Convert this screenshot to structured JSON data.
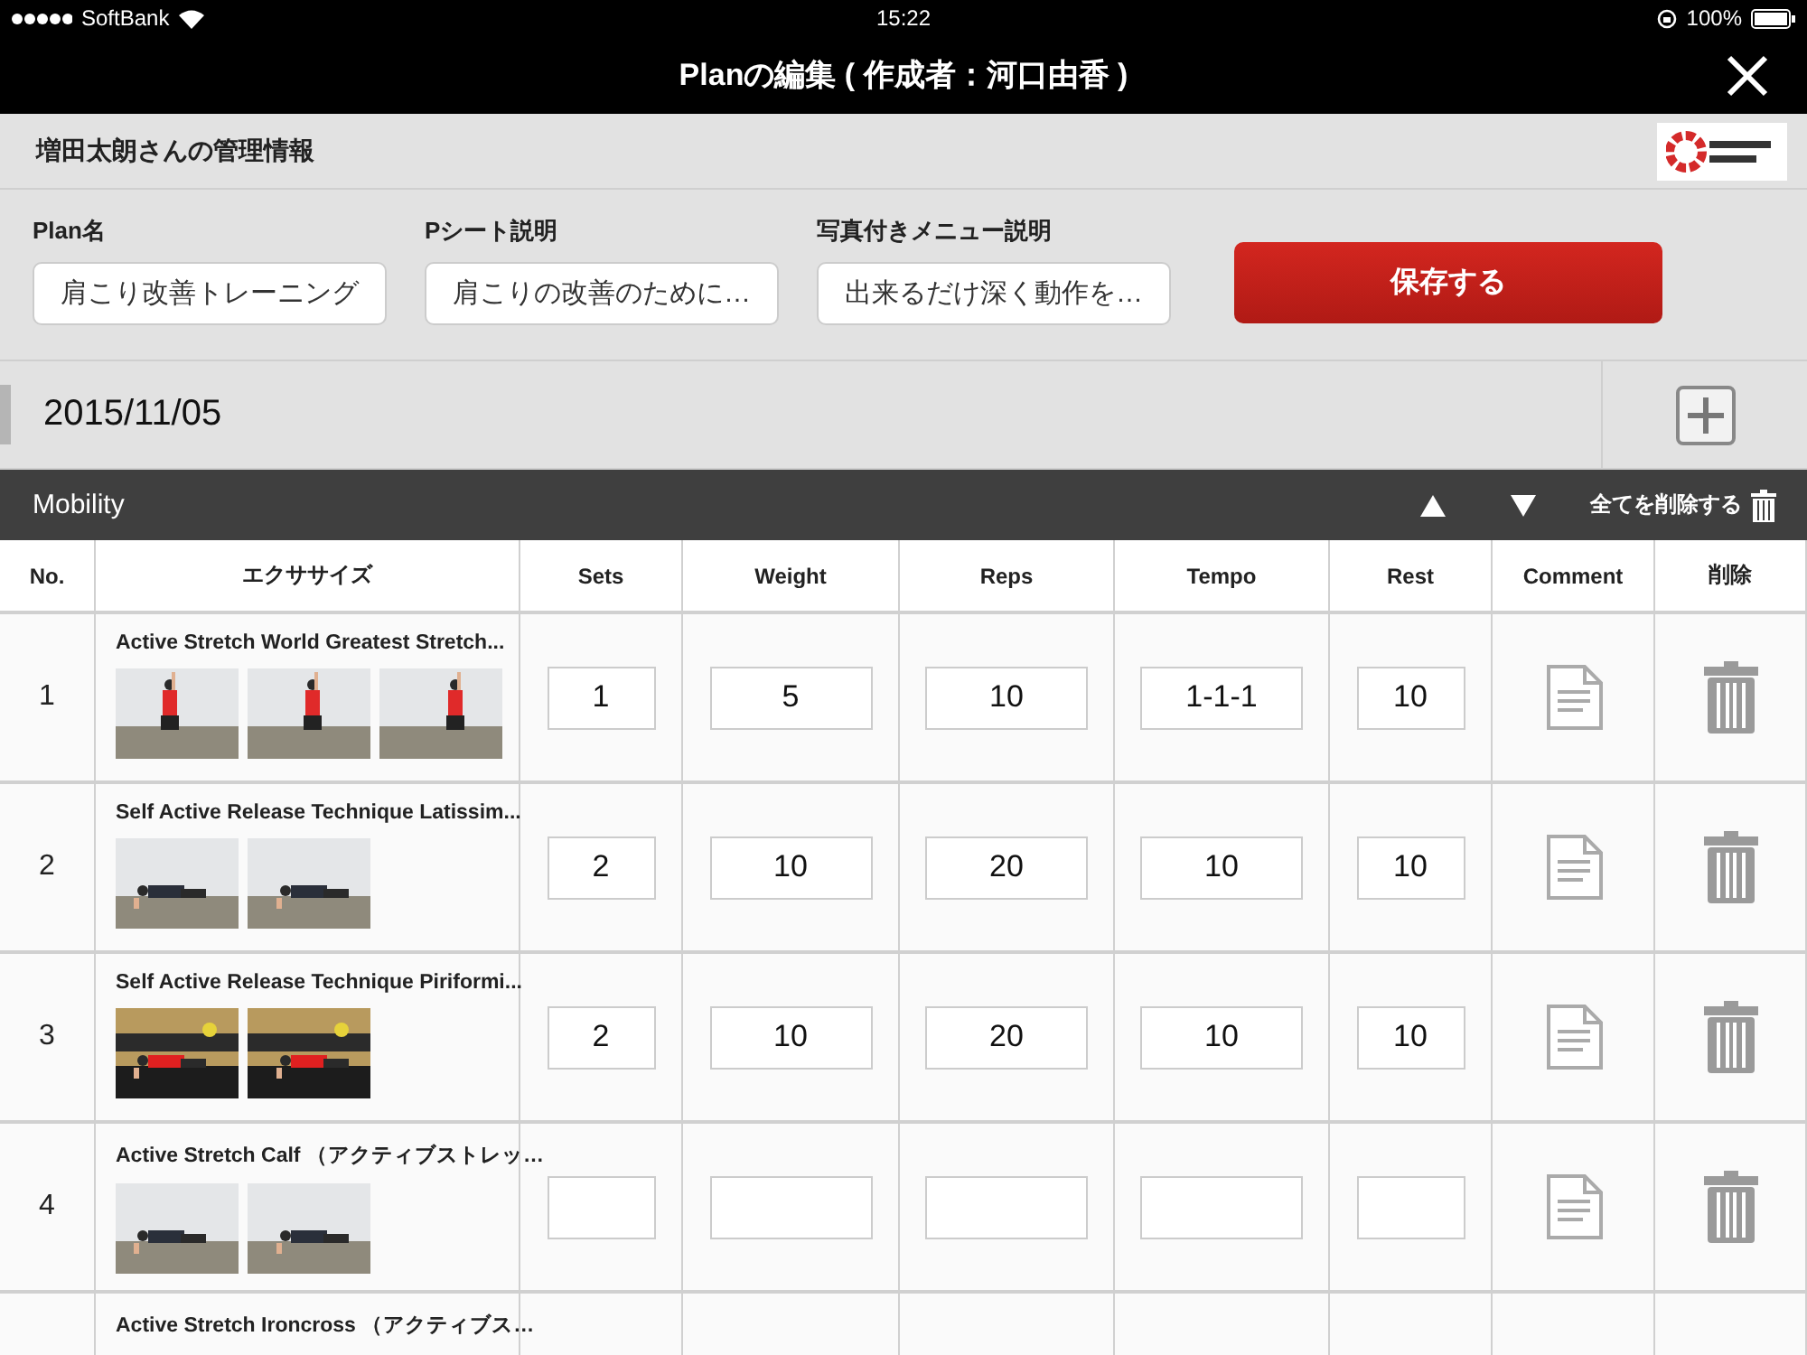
{
  "status_bar": {
    "carrier": "SoftBank",
    "time": "15:22",
    "battery": "100%"
  },
  "title_bar": {
    "title": "Planの編集 ( 作成者：河口由香 )"
  },
  "header": {
    "title": "増田太朗さんの管理情報"
  },
  "form": {
    "fields": [
      {
        "label": "Plan名",
        "value": "肩こり改善トレーニング"
      },
      {
        "label": "Pシート説明",
        "value": "肩こりの改善のために…"
      },
      {
        "label": "写真付きメニュー説明",
        "value": "出来るだけ深く動作を…"
      }
    ],
    "save_button": "保存する"
  },
  "date": "2015/11/05",
  "section": {
    "title": "Mobility",
    "delete_all": "全てを削除する"
  },
  "table": {
    "columns": [
      "No.",
      "エクササイズ",
      "Sets",
      "Weight",
      "Reps",
      "Tempo",
      "Rest",
      "Comment",
      "削除"
    ],
    "rows": [
      {
        "no": "1",
        "title": "Active Stretch World Greatest Stretch...",
        "sets": "1",
        "weight": "5",
        "reps": "10",
        "tempo": "1-1-1",
        "rest": "10"
      },
      {
        "no": "2",
        "title": "Self Active Release Technique Latissim...",
        "sets": "2",
        "weight": "10",
        "reps": "20",
        "tempo": "10",
        "rest": "10"
      },
      {
        "no": "3",
        "title": "Self Active Release Technique Piriformi...",
        "sets": "2",
        "weight": "10",
        "reps": "20",
        "tempo": "10",
        "rest": "10"
      },
      {
        "no": "4",
        "title": "Active Stretch Calf （アクティブストレッ…"
      },
      {
        "title": "Active Stretch Ironcross （アクティブス…"
      }
    ]
  }
}
